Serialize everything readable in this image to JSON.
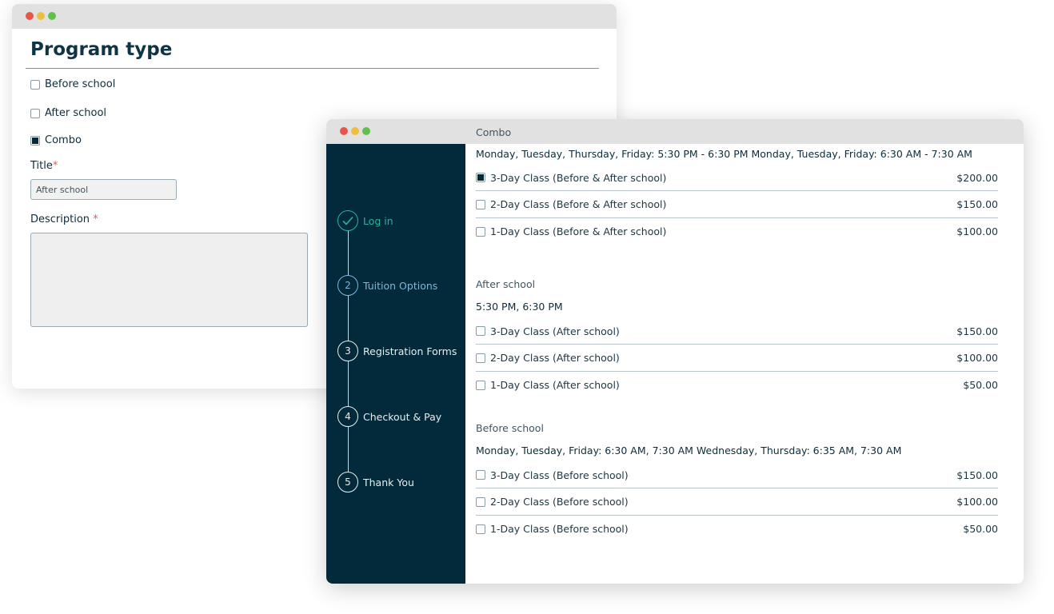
{
  "back_window": {
    "heading": "Program type",
    "program_options": [
      {
        "label": "Before school",
        "checked": false
      },
      {
        "label": "After school",
        "checked": false
      },
      {
        "label": "Combo",
        "checked": true
      }
    ],
    "title_label": "Title",
    "required_mark": "*",
    "title_value": "After school",
    "description_label": "Description",
    "description_value": ""
  },
  "front_window": {
    "steps": [
      {
        "number": "",
        "label": "Log in",
        "state": "complete",
        "icon": "check-icon"
      },
      {
        "number": "2",
        "label": "Tuition Options",
        "state": "current"
      },
      {
        "number": "3",
        "label": "Registration Forms",
        "state": "upcoming"
      },
      {
        "number": "4",
        "label": "Checkout & Pay",
        "state": "upcoming"
      },
      {
        "number": "5",
        "label": "Thank You",
        "state": "upcoming"
      }
    ],
    "sections": [
      {
        "label": "Combo",
        "schedule": "Monday, Tuesday, Thursday, Friday: 5:30 PM - 6:30 PM Monday, Tuesday, Friday: 6:30 AM - 7:30 AM",
        "options": [
          {
            "label": "3-Day Class (Before & After school)",
            "price": "$200.00",
            "checked": true
          },
          {
            "label": "2-Day Class (Before & After school)",
            "price": "$150.00",
            "checked": false
          },
          {
            "label": "1-Day Class (Before & After school)",
            "price": "$100.00",
            "checked": false
          }
        ]
      },
      {
        "label": "After school",
        "schedule": "5:30 PM, 6:30 PM",
        "options": [
          {
            "label": "3-Day Class (After school)",
            "price": "$150.00",
            "checked": false
          },
          {
            "label": "2-Day Class (After school)",
            "price": "$100.00",
            "checked": false
          },
          {
            "label": "1-Day Class (After school)",
            "price": "$50.00",
            "checked": false
          }
        ]
      },
      {
        "label": "Before school",
        "schedule": "Monday, Tuesday, Friday: 6:30 AM, 7:30 AM Wednesday, Thursday: 6:35 AM, 7:30 AM",
        "options": [
          {
            "label": "3-Day Class (Before school)",
            "price": "$150.00",
            "checked": false
          },
          {
            "label": "2-Day Class (Before school)",
            "price": "$100.00",
            "checked": false
          },
          {
            "label": "1-Day Class (Before school)",
            "price": "$50.00",
            "checked": false
          }
        ]
      }
    ]
  },
  "colors": {
    "sidebar": "#022a3a",
    "complete": "#2bb39a",
    "current": "#7fb6dd",
    "traffic_red": "#e5574d",
    "traffic_yellow": "#eebf3f",
    "traffic_green": "#5fc04c"
  }
}
